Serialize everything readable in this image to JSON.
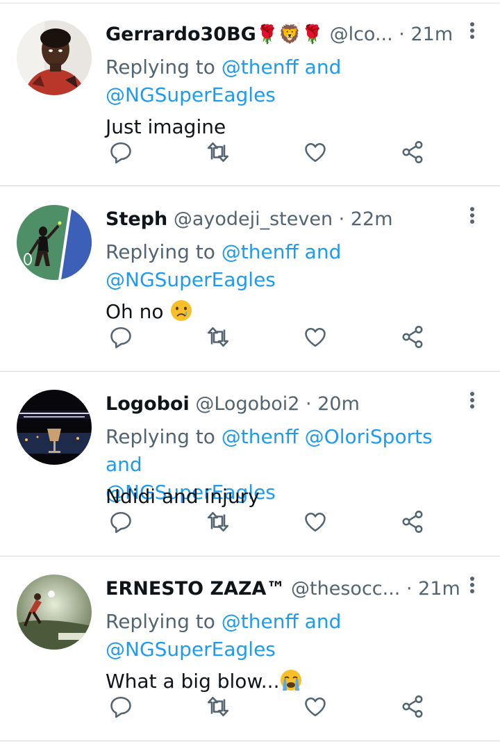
{
  "tweets": [
    {
      "name": "Gerrardo30BG",
      "name_emoji": "🌹🦁🌹",
      "handle": "@lco...",
      "dot": "·",
      "time": "21m",
      "replying_prefix": "Replying to",
      "mention_1": "@thenff",
      "mention_2": "",
      "replying_and": "and",
      "mention_last": "@NGSuperEagles",
      "text": "Just imagine",
      "text_emoji": "",
      "avatar": "person-portrait"
    },
    {
      "name": "Steph",
      "name_emoji": "",
      "handle": "@ayodeji_steven",
      "dot": "·",
      "time": "22m",
      "replying_prefix": "Replying to",
      "mention_1": "@thenff",
      "mention_2": "",
      "replying_and": "and",
      "mention_last": "@NGSuperEagles",
      "text": "Oh no",
      "text_emoji": "crying-face",
      "avatar": "tennis-player"
    },
    {
      "name": "Logoboi",
      "name_emoji": "",
      "handle": "@Logoboi2",
      "dot": "·",
      "time": "20m",
      "replying_prefix": "Replying to",
      "mention_1": "@thenff",
      "mention_2": "@OloriSports",
      "replying_and": "and",
      "mention_last": "@NGSuperEagles",
      "text": "Ndidi and injury",
      "text_emoji": "",
      "avatar": "night-wineglass"
    },
    {
      "name": "ERNESTO ZAZA™",
      "name_emoji": "",
      "handle": "@thesocc...",
      "dot": "·",
      "time": "21m",
      "replying_prefix": "Replying to",
      "mention_1": "@thenff",
      "mention_2": "",
      "replying_and": "and",
      "mention_last": "@NGSuperEagles",
      "text": "What a big blow...",
      "text_emoji": "loudly-crying-face",
      "avatar": "soccer-player"
    }
  ],
  "icons": {
    "reply": "reply-icon",
    "retweet": "retweet-icon",
    "like": "like-icon",
    "share": "share-icon",
    "menu": "more-vertical-icon"
  },
  "colors": {
    "mention": "#1d9bf0",
    "secondary": "#536471",
    "icon": "#536471",
    "divider": "#d6d9db"
  }
}
